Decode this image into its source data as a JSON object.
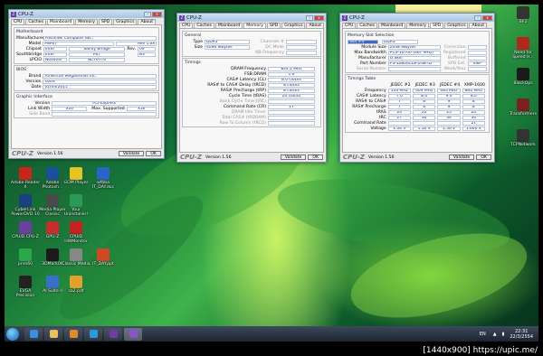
{
  "desktop": {
    "icons_left": [
      {
        "label": "Adobe Reader X",
        "color": "#c8261d"
      },
      {
        "label": "Adobe Photosh...",
        "color": "#1c4f9a"
      },
      {
        "label": "GOM Player",
        "color": "#e6c421"
      },
      {
        "label": "wfbba IT_DAY.doc",
        "color": "#2a64c4"
      },
      {
        "label": "CyberLink PowerDVD 10",
        "color": "#1b3f80"
      },
      {
        "label": "Media Player Classic",
        "color": "#4a4a4a"
      },
      {
        "label": "Your Uninstaller!",
        "color": "#2b9a55"
      },
      {
        "label": "CPUID CPU-Z",
        "color": "#6a3fa0"
      },
      {
        "label": "GPU-Z",
        "color": "#c82d2d"
      },
      {
        "label": "CPUID HWMonitor",
        "color": "#c42222"
      },
      {
        "label": "pnm60",
        "color": "#2ba84a"
      },
      {
        "label": "3DMark06",
        "color": "#1b1b1b"
      },
      {
        "label": "Classic Media",
        "color": "#888888"
      },
      {
        "label": "IT_DAY.ppt",
        "color": "#d24726"
      },
      {
        "label": "EVGA Precision",
        "color": "#222222"
      },
      {
        "label": "AI Suite II",
        "color": "#3a6ecb"
      },
      {
        "label": "sa2.pdf",
        "color": "#e0a22a"
      }
    ],
    "icons_right": [
      {
        "label": "BF2",
        "color": "#333333"
      },
      {
        "label": "Need for Speed H...",
        "color": "#b0281a"
      },
      {
        "label": "BlackOps",
        "color": "#1a1a1a"
      },
      {
        "label": "Transformers",
        "color": "#7a2020"
      },
      {
        "label": "TCPNetwork",
        "color": "#333333"
      }
    ]
  },
  "cpuz1": {
    "title": "CPU-Z",
    "tabs": [
      "CPU",
      "Caches",
      "Mainboard",
      "Memory",
      "SPD",
      "Graphics",
      "About"
    ],
    "active": "Mainboard",
    "motherboard_title": "Motherboard",
    "mb": {
      "manufacturer_l": "Manufacturer",
      "manufacturer": "ASUSTeK Computer INC.",
      "model_l": "Model",
      "model": "P8P67",
      "rev": "Rev 1.xx",
      "chipset_l": "Chipset",
      "chipset_v": "Intel",
      "chipset": "Sandy Bridge",
      "rev_l": "Rev.",
      "chipset_rev": "09",
      "south_l": "Southbridge",
      "south_v": "Intel",
      "south": "P67",
      "south_rev": "B3",
      "lpcio_l": "LPCIO",
      "lpcio_v": "Nuvoton",
      "lpcio": "NCT6776"
    },
    "bios_title": "BIOS",
    "bios": {
      "brand_l": "Brand",
      "brand": "American Megatrends Inc.",
      "version_l": "Version",
      "version": "1003",
      "date_l": "Date",
      "date": "01/04/2011"
    },
    "gi_title": "Graphic Interface",
    "gi": {
      "version_l": "Version",
      "version": "PCI-Express",
      "lw_l": "Link Width",
      "lw": "x16",
      "ms_l": "Max. Supported",
      "ms": "x16",
      "sb_l": "Side Band"
    },
    "version": "Version 1.56",
    "validate": "Validate",
    "ok": "OK"
  },
  "cpuz2": {
    "title": "CPU-Z",
    "tabs": [
      "CPU",
      "Caches",
      "Mainboard",
      "Memory",
      "SPD",
      "Graphics",
      "About"
    ],
    "active": "Memory",
    "general_title": "General",
    "gen": {
      "type_l": "Type",
      "type": "DDR3",
      "channels_l": "Channels #",
      "size_l": "Size",
      "size": "4096 MBytes",
      "dc_l": "DC Mode",
      "nb_l": "NB Frequency"
    },
    "timings_title": "Timings",
    "t": [
      {
        "l": "DRAM Frequency",
        "v": "824.2 MHz"
      },
      {
        "l": "FSB:DRAM",
        "v": "1:6"
      },
      {
        "l": "CAS# Latency (CL)",
        "v": "8.0 clocks"
      },
      {
        "l": "RAS# to CAS# Delay (tRCD)",
        "v": "8 clocks"
      },
      {
        "l": "RAS# Precharge (tRP)",
        "v": "8 clocks"
      },
      {
        "l": "Cycle Time (tRAS)",
        "v": "24 clocks"
      },
      {
        "l": "Bank Cycle Time (tRC)",
        "v": ""
      },
      {
        "l": "Command Rate (CR)",
        "v": "2T"
      },
      {
        "l": "DRAM Idle Timer",
        "v": ""
      },
      {
        "l": "Total CAS# (tRDRAM)",
        "v": ""
      },
      {
        "l": "Row To Column (tRCD)",
        "v": ""
      }
    ],
    "version": "Version 1.56",
    "validate": "Validate",
    "ok": "OK"
  },
  "cpuz3": {
    "title": "CPU-Z",
    "tabs": [
      "CPU",
      "Caches",
      "Mainboard",
      "Memory",
      "SPD",
      "Graphics",
      "About"
    ],
    "active": "SPD",
    "slot_title": "Memory Slot Selection",
    "slot": "Slot #4",
    "slot_type": "DDR3",
    "spd": [
      {
        "l": "Module Size",
        "v": "2048 MBytes",
        "r": "Correction"
      },
      {
        "l": "Max Bandwidth",
        "v": "PC3-10700 (667 MHz)",
        "r": "Registered"
      },
      {
        "l": "Manufacturer",
        "v": "G.Skill",
        "r": "Buffered"
      },
      {
        "l": "Part Number",
        "v": "F3-12800CL8-2GBTD",
        "r": "SPD Ext.",
        "rv": "XMP"
      },
      {
        "l": "Serial Number",
        "v": "",
        "r": "Week/Year"
      }
    ],
    "tt_title": "Timings Table",
    "tt_head": [
      "JEDEC #2",
      "JEDEC #3",
      "JEDEC #4",
      "XMP-1600"
    ],
    "tt": [
      {
        "l": "Frequency",
        "v": [
          "533 MHz",
          "609 MHz",
          "685 MHz",
          "800 MHz"
        ]
      },
      {
        "l": "CAS# Latency",
        "v": [
          "7.0",
          "8.0",
          "9.0",
          "8.0"
        ]
      },
      {
        "l": "RAS# to CAS#",
        "v": [
          "7",
          "8",
          "9",
          "8"
        ]
      },
      {
        "l": "RAS# Precharge",
        "v": [
          "7",
          "8",
          "9",
          "8"
        ]
      },
      {
        "l": "tRAS",
        "v": [
          "20",
          "22",
          "25",
          "24"
        ]
      },
      {
        "l": "tRC",
        "v": [
          "27",
          "30",
          "34",
          "34"
        ]
      },
      {
        "l": "Command Rate",
        "v": [
          "",
          "",
          "",
          "2T"
        ]
      },
      {
        "l": "Voltage",
        "v": [
          "1.50 V",
          "1.50 V",
          "1.50 V",
          "1.600 V"
        ]
      }
    ],
    "version": "Version 1.56",
    "validate": "Validate",
    "ok": "OK"
  },
  "taskbar": {
    "lang": "EN",
    "time": "22:31",
    "date": "22/3/2554"
  },
  "watermark": "[1440x900] https://upic.me/"
}
